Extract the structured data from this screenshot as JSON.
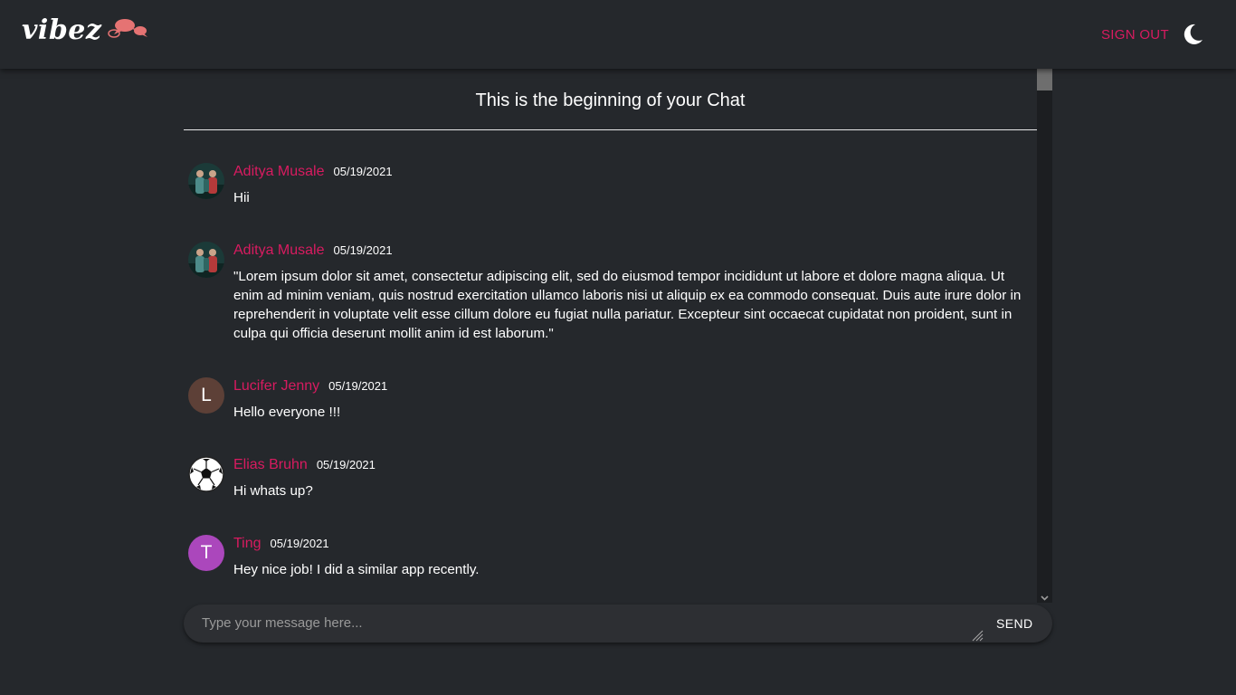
{
  "header": {
    "logo_text": "vibez",
    "logo_icon": "chat-bubbles-icon",
    "sign_out_label": "SIGN OUT",
    "theme_toggle_icon": "moon-icon"
  },
  "chat": {
    "title": "This is the beginning of your Chat",
    "messages": [
      {
        "author": "Aditya Musale",
        "date": "05/19/2021",
        "text": "Hii",
        "avatar_type": "photo",
        "avatar_letter": ""
      },
      {
        "author": "Aditya Musale",
        "date": "05/19/2021",
        "text": "\"Lorem ipsum dolor sit amet, consectetur adipiscing elit, sed do eiusmod tempor incididunt ut labore et dolore magna aliqua. Ut enim ad minim veniam, quis nostrud exercitation ullamco laboris nisi ut aliquip ex ea commodo consequat. Duis aute irure dolor in reprehenderit in voluptate velit esse cillum dolore eu fugiat nulla pariatur. Excepteur sint occaecat cupidatat non proident, sunt in culpa qui officia deserunt mollit anim id est laborum.\"",
        "avatar_type": "photo",
        "avatar_letter": ""
      },
      {
        "author": "Lucifer Jenny",
        "date": "05/19/2021",
        "text": "Hello everyone !!!",
        "avatar_type": "letter",
        "avatar_letter": "L",
        "avatar_color": "#5d4037"
      },
      {
        "author": "Elias Bruhn",
        "date": "05/19/2021",
        "text": "Hi whats up?",
        "avatar_type": "soccer-ball-icon",
        "avatar_letter": ""
      },
      {
        "author": "Ting",
        "date": "05/19/2021",
        "text": "Hey nice job! I did a similar app recently.",
        "avatar_type": "letter",
        "avatar_letter": "T",
        "avatar_color": "#ab47bc"
      }
    ]
  },
  "composer": {
    "placeholder": "Type your message here...",
    "value": "",
    "send_label": "SEND"
  },
  "colors": {
    "background": "#25282c",
    "accent": "#d81b60",
    "composer": "#2d2f33"
  }
}
